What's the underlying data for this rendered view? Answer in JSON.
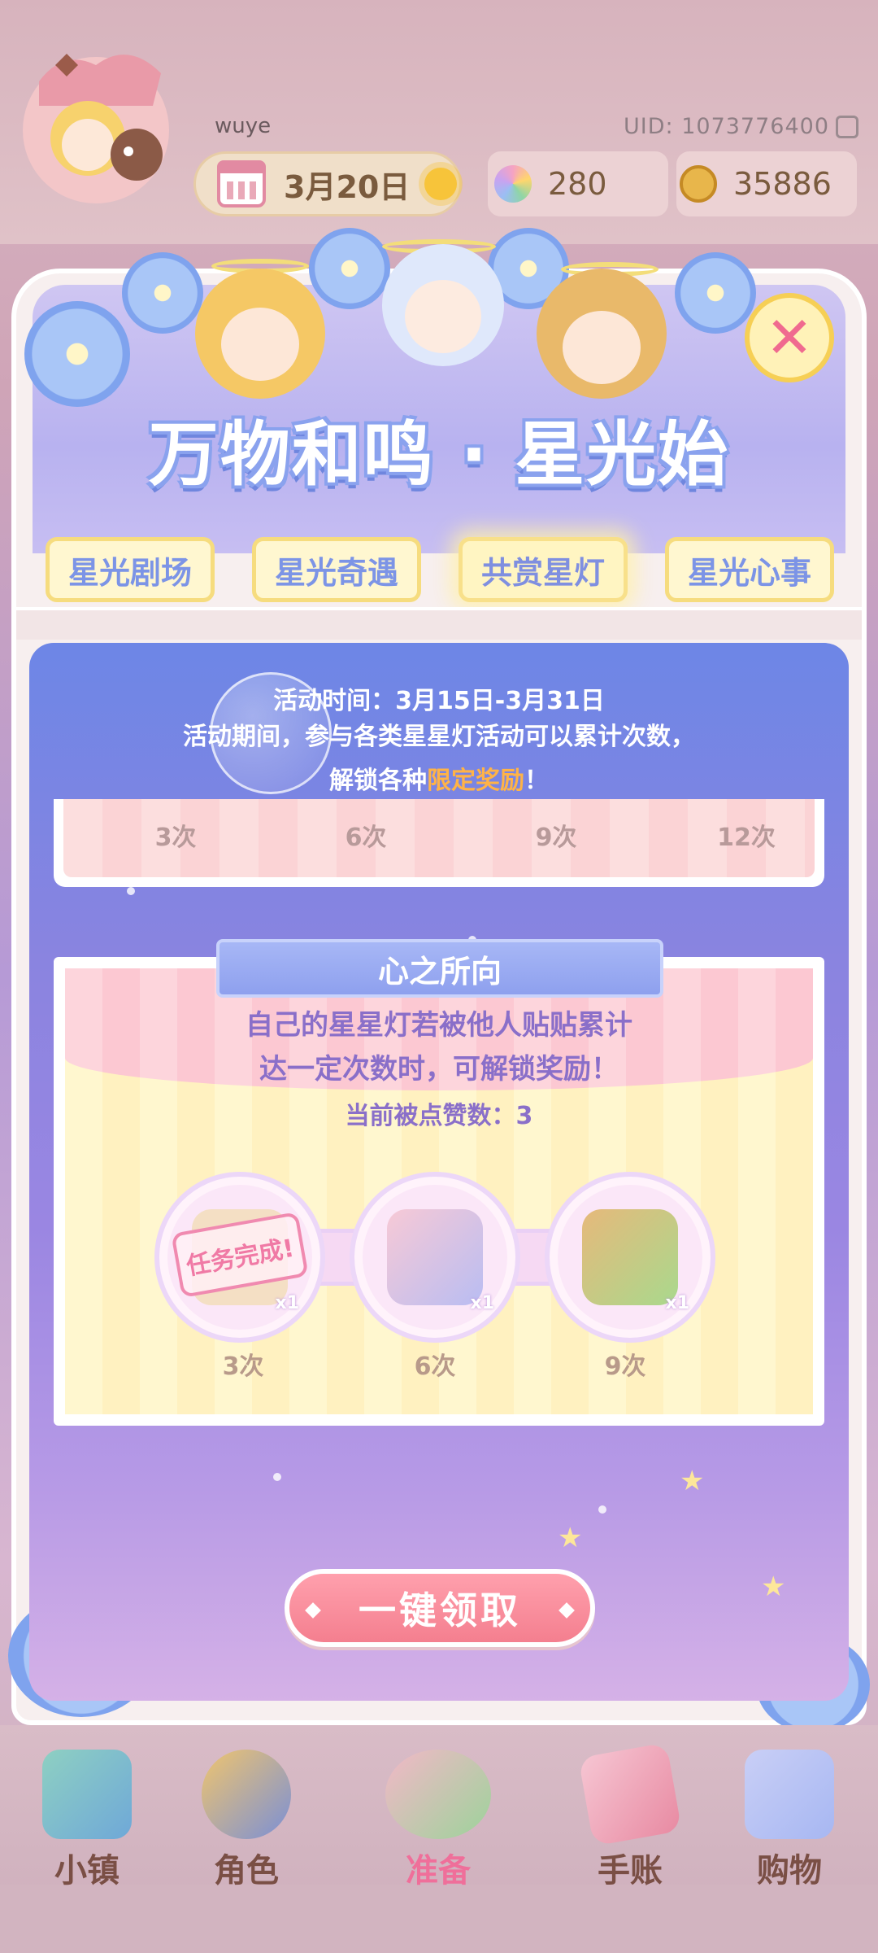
{
  "hud": {
    "username": "wuye",
    "uid": "UID: 1073776400",
    "date": "3月20日",
    "gems": "280",
    "coins": "35886"
  },
  "event": {
    "title": "万物和鸣 · 星光始",
    "tabs": [
      {
        "label": "星光剧场",
        "active": false
      },
      {
        "label": "星光奇遇",
        "active": false
      },
      {
        "label": "共赏星灯",
        "active": true
      },
      {
        "label": "星光心事",
        "active": false
      }
    ],
    "time_line": "活动时间：3月15日-3月31日",
    "desc_line1": "活动期间，参与各类星星灯活动可以累计次数，",
    "desc_line2_prefix": "解锁各种",
    "desc_line2_highlight": "限定奖励",
    "desc_line2_suffix": "！",
    "milestones": [
      "3次",
      "6次",
      "9次",
      "12次"
    ]
  },
  "card": {
    "title": "心之所向",
    "line1": "自己的星星灯若被他人贴贴累计",
    "line2": "达一定次数时，可解锁奖励！",
    "likes": "当前被点赞数：3",
    "finish_stamp": "任务完成!",
    "rewards": [
      {
        "label": "3次",
        "qty": "x1",
        "icon": "task-complete-reward-icon",
        "completed": true
      },
      {
        "label": "6次",
        "qty": "x1",
        "icon": "makeup-palette-reward-icon",
        "completed": false
      },
      {
        "label": "9次",
        "qty": "x1",
        "icon": "food-bag-reward-icon",
        "completed": false
      }
    ]
  },
  "claim_button": "一键领取",
  "nav": [
    {
      "label": "小镇",
      "icon": "map-icon"
    },
    {
      "label": "角色",
      "icon": "character-icon"
    },
    {
      "label": "准备",
      "icon": "prepare-icon"
    },
    {
      "label": "手账",
      "icon": "journal-icon"
    },
    {
      "label": "购物",
      "icon": "shopping-bag-icon"
    }
  ],
  "colors": {
    "accent_blue": "#7c94e6",
    "claim_pink": "#f47f8f",
    "highlight_orange": "#ffb347",
    "text_purple": "#8a6fc9"
  }
}
